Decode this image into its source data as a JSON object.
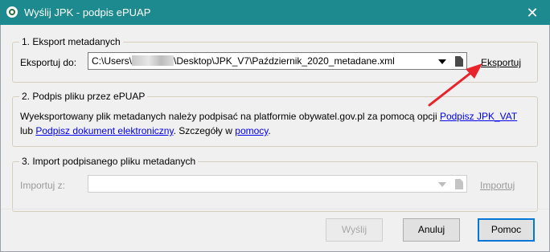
{
  "window": {
    "title": "Wyślij JPK - podpis ePUAP",
    "close_glyph": "✕"
  },
  "export_group": {
    "title": "1. Eksport metadanych",
    "label": "Eksportuj do:",
    "path_prefix": "C:\\Users\\",
    "path_suffix": "\\Desktop\\JPK_V7\\Październik_2020_metadane.xml",
    "button": "Eksportuj"
  },
  "sign_group": {
    "title": "2. Podpis pliku przez ePUAP",
    "line1_text": "Wyeksportowany plik metadanych należy podpisać na platformie obywatel.gov.pl za pomocą opcji ",
    "line1_link": "Podpisz JPK_VAT",
    "line2_prefix": "lub ",
    "line2_link": "Podpisz dokument elektroniczny",
    "line2_mid": ". Szczegóły w ",
    "line2_help_link": "pomocy",
    "line2_end": "."
  },
  "import_group": {
    "title": "3. Import podpisanego pliku metadanych",
    "label": "Importuj z:",
    "value": "",
    "button": "Importuj"
  },
  "footer": {
    "send_label": "Wyślij",
    "cancel_label": "Anuluj",
    "help_label": "Pomoc"
  },
  "colors": {
    "titlebar": "#1c8a8e",
    "annotation_arrow": "#e8232a",
    "link": "#0000ee"
  }
}
